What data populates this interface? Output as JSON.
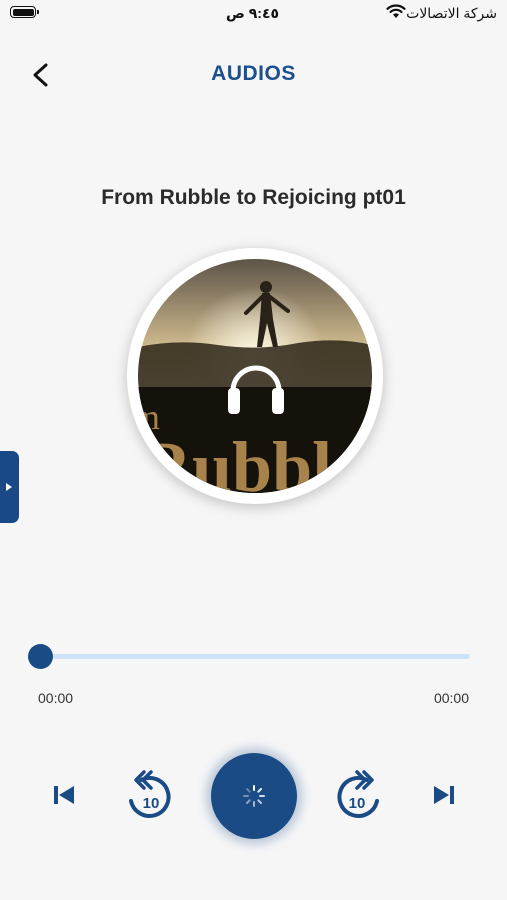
{
  "status_bar": {
    "carrier": "شركة الاتصالات",
    "time": "٩:٤٥ ص",
    "icons": [
      "battery-icon",
      "wifi-icon"
    ]
  },
  "header": {
    "title": "AUDIOS",
    "back_icon": "chevron-left-icon"
  },
  "track": {
    "title": "From Rubble to Rejoicing pt01",
    "artwork_text": "Rubbl",
    "artwork_text_prefix": "m"
  },
  "player": {
    "elapsed": "00:00",
    "total": "00:00",
    "progress": 0,
    "rewind_seconds": "10",
    "forward_seconds": "10",
    "state": "loading"
  },
  "colors": {
    "accent": "#1b4b85",
    "title": "#1d4f8f",
    "track_bg": "#cfe3f8",
    "background": "#f6f6f7"
  }
}
